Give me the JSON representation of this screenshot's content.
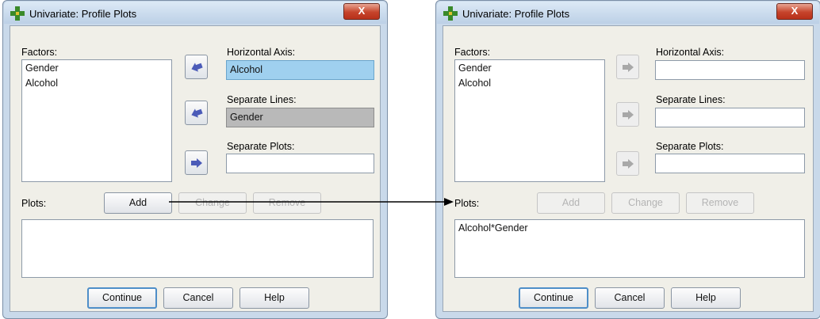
{
  "left_dialog": {
    "title": "Univariate: Profile Plots",
    "close_label": "X",
    "factors_label": "Factors:",
    "factors": [
      "Gender",
      "Alcohol"
    ],
    "horizontal_axis_label": "Horizontal Axis:",
    "horizontal_axis_value": "Alcohol",
    "separate_lines_label": "Separate Lines:",
    "separate_lines_value": "Gender",
    "separate_plots_label": "Separate Plots:",
    "separate_plots_value": "",
    "plots_label": "Plots:",
    "add_label": "Add",
    "change_label": "Change",
    "remove_label": "Remove",
    "plots_items": [
      ""
    ],
    "continue_label": "Continue",
    "cancel_label": "Cancel",
    "help_label": "Help"
  },
  "right_dialog": {
    "title": "Univariate: Profile Plots",
    "close_label": "X",
    "factors_label": "Factors:",
    "factors": [
      "Gender",
      "Alcohol"
    ],
    "horizontal_axis_label": "Horizontal Axis:",
    "horizontal_axis_value": "",
    "separate_lines_label": "Separate Lines:",
    "separate_lines_value": "",
    "separate_plots_label": "Separate Plots:",
    "separate_plots_value": "",
    "plots_label": "Plots:",
    "add_label": "Add",
    "change_label": "Change",
    "remove_label": "Remove",
    "plots_items": [
      "Alcohol*Gender"
    ],
    "continue_label": "Continue",
    "cancel_label": "Cancel",
    "help_label": "Help"
  },
  "colors": {
    "selected_field": "#9fd0ef",
    "grey_field": "#b9b9b9",
    "arrow_enabled": "#4b5bb8",
    "arrow_disabled": "#a8a8a8",
    "close_button": "#c6442b"
  }
}
